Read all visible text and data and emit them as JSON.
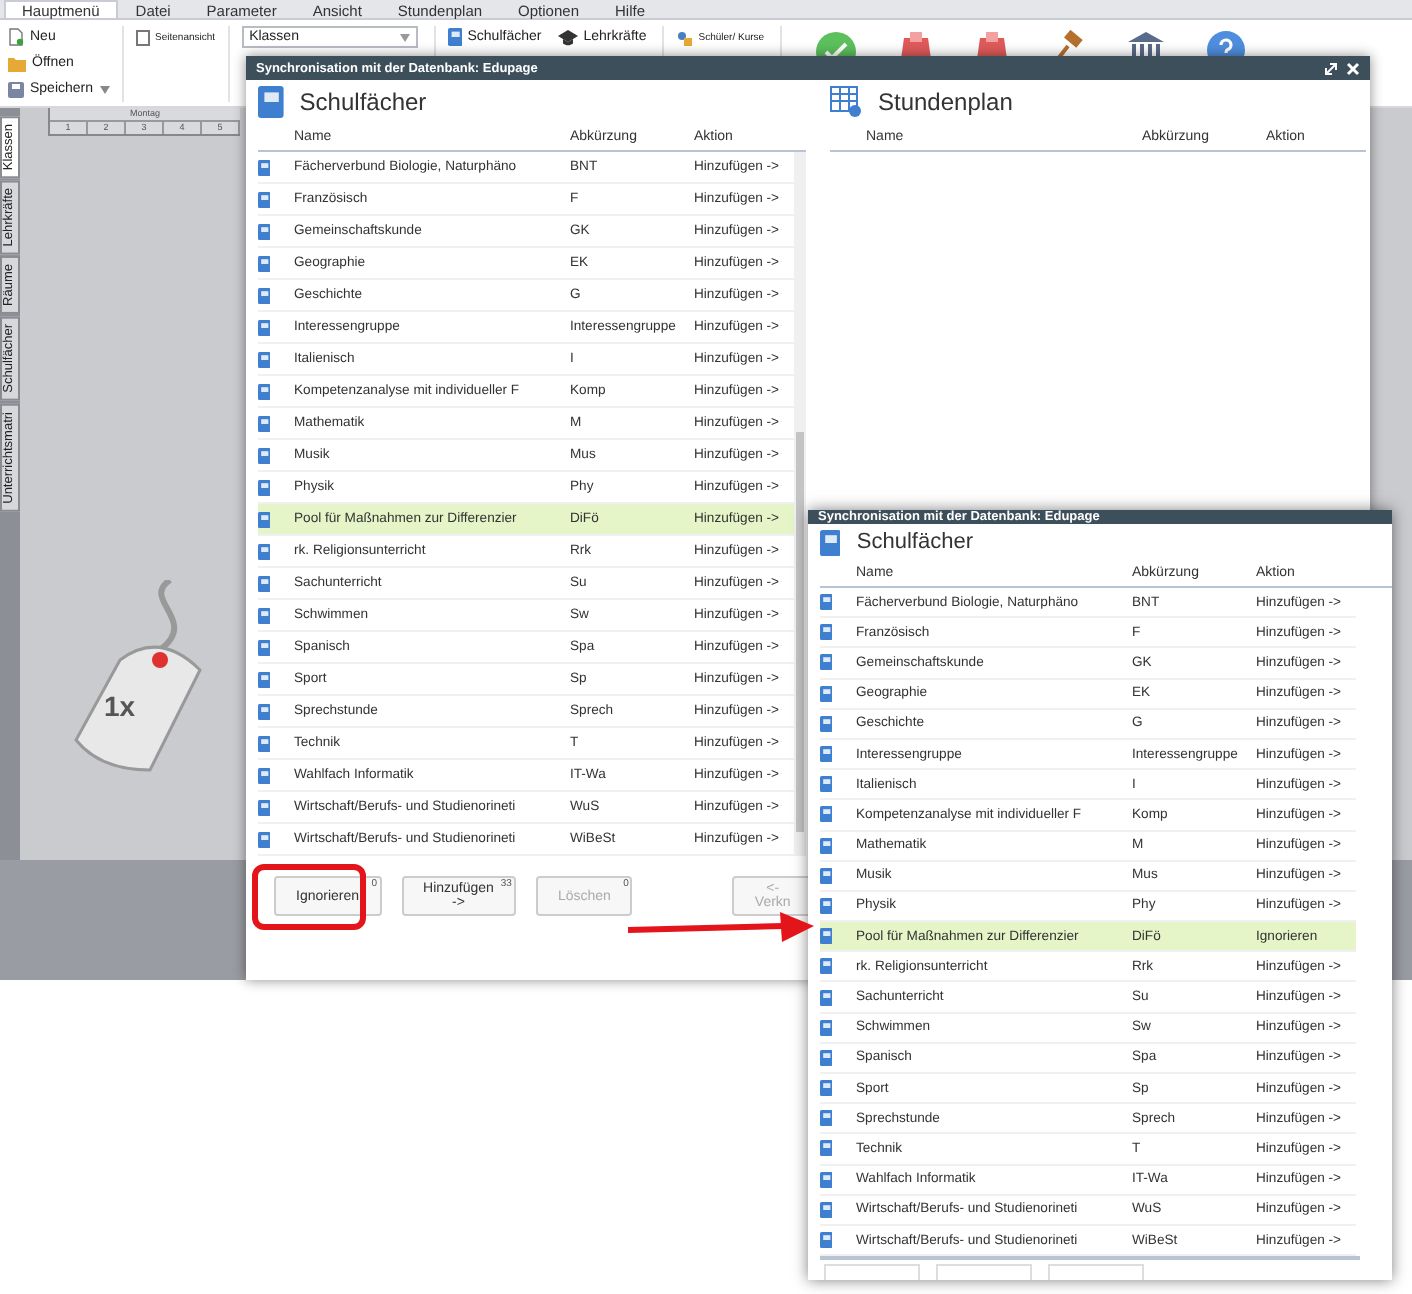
{
  "menu": [
    {
      "label": "Hauptmenü",
      "selected": true
    },
    {
      "label": "Datei",
      "selected": false
    },
    {
      "label": "Parameter",
      "selected": false
    },
    {
      "label": "Ansicht",
      "selected": false
    },
    {
      "label": "Stundenplan",
      "selected": false
    },
    {
      "label": "Optionen",
      "selected": false
    },
    {
      "label": "Hilfe",
      "selected": false
    }
  ],
  "ribbon": {
    "file_items": [
      {
        "kind": "new",
        "label": "Neu"
      },
      {
        "kind": "open",
        "label": "Öffnen"
      },
      {
        "kind": "save",
        "label": "Speichern"
      }
    ],
    "page_view": "Seitenansicht",
    "view_select": "Klassen",
    "list_buttons": [
      {
        "kind": "subject",
        "label": "Schulfächer"
      },
      {
        "kind": "teacher",
        "label": "Lehrkräfte"
      }
    ],
    "students_button": "Schüler/ Kurse"
  },
  "side_tabs": [
    {
      "label": "Klassen",
      "selected": true
    },
    {
      "label": "Lehrkräfte",
      "selected": false
    },
    {
      "label": "Räume",
      "selected": false
    },
    {
      "label": "Schulfächer",
      "selected": false
    },
    {
      "label": "Unterrichtsmatri",
      "selected": false
    }
  ],
  "timetable": {
    "day": "Montag",
    "periods": [
      "1",
      "2",
      "3",
      "4",
      "5"
    ]
  },
  "dialog": {
    "title": "Synchronisation mit der Datenbank: Edupage",
    "left": {
      "title": "Schulfächer",
      "columns": [
        "Name",
        "Abkürzung",
        "Aktion"
      ],
      "rows": [
        {
          "name": "Fächerverbund Biologie, Naturphäno",
          "abbr": "BNT",
          "action": "Hinzufügen ->",
          "selected": false
        },
        {
          "name": "Französisch",
          "abbr": "F",
          "action": "Hinzufügen ->",
          "selected": false
        },
        {
          "name": "Gemeinschaftskunde",
          "abbr": "GK",
          "action": "Hinzufügen ->",
          "selected": false
        },
        {
          "name": "Geographie",
          "abbr": "EK",
          "action": "Hinzufügen ->",
          "selected": false
        },
        {
          "name": "Geschichte",
          "abbr": "G",
          "action": "Hinzufügen ->",
          "selected": false
        },
        {
          "name": "Interessengruppe",
          "abbr": "Interessengruppe",
          "action": "Hinzufügen ->",
          "selected": false
        },
        {
          "name": "Italienisch",
          "abbr": "I",
          "action": "Hinzufügen ->",
          "selected": false
        },
        {
          "name": "Kompetenzanalyse mit individueller F",
          "abbr": "Komp",
          "action": "Hinzufügen ->",
          "selected": false
        },
        {
          "name": "Mathematik",
          "abbr": "M",
          "action": "Hinzufügen ->",
          "selected": false
        },
        {
          "name": "Musik",
          "abbr": "Mus",
          "action": "Hinzufügen ->",
          "selected": false
        },
        {
          "name": "Physik",
          "abbr": "Phy",
          "action": "Hinzufügen ->",
          "selected": false
        },
        {
          "name": "Pool für Maßnahmen zur Differenzier",
          "abbr": "DiFö",
          "action": "Hinzufügen ->",
          "selected": true
        },
        {
          "name": "rk. Religionsunterricht",
          "abbr": "Rrk",
          "action": "Hinzufügen ->",
          "selected": false
        },
        {
          "name": "Sachunterricht",
          "abbr": "Su",
          "action": "Hinzufügen ->",
          "selected": false
        },
        {
          "name": "Schwimmen",
          "abbr": "Sw",
          "action": "Hinzufügen ->",
          "selected": false
        },
        {
          "name": "Spanisch",
          "abbr": "Spa",
          "action": "Hinzufügen ->",
          "selected": false
        },
        {
          "name": "Sport",
          "abbr": "Sp",
          "action": "Hinzufügen ->",
          "selected": false
        },
        {
          "name": "Sprechstunde",
          "abbr": "Sprech",
          "action": "Hinzufügen ->",
          "selected": false
        },
        {
          "name": "Technik",
          "abbr": "T",
          "action": "Hinzufügen ->",
          "selected": false
        },
        {
          "name": "Wahlfach Informatik",
          "abbr": "IT-Wa",
          "action": "Hinzufügen ->",
          "selected": false
        },
        {
          "name": "Wirtschaft/Berufs- und Studienorineti",
          "abbr": "WuS",
          "action": "Hinzufügen ->",
          "selected": false
        },
        {
          "name": "Wirtschaft/Berufs- und Studienorineti",
          "abbr": "WiBeSt",
          "action": "Hinzufügen ->",
          "selected": false
        }
      ]
    },
    "right": {
      "title": "Stundenplan",
      "columns": [
        "Name",
        "Abkürzung",
        "Aktion"
      ]
    },
    "buttons": [
      {
        "label": "Ignorieren",
        "count": "0",
        "disabled": false,
        "highlighted": true
      },
      {
        "label": "Hinzufügen ->",
        "count": "33",
        "disabled": false,
        "highlighted": false
      },
      {
        "label": "Löschen",
        "count": "0",
        "disabled": true,
        "highlighted": false
      }
    ],
    "link_button": "<- Verkn"
  },
  "zoom_inset": {
    "title": "Synchronisation mit der Datenbank: Edupage",
    "panel_title": "Schulfächer",
    "columns": [
      "Name",
      "Abkürzung",
      "Aktion"
    ],
    "rows": [
      {
        "name": "Fächerverbund Biologie, Naturphäno",
        "abbr": "BNT",
        "action": "Hinzufügen ->",
        "selected": false
      },
      {
        "name": "Französisch",
        "abbr": "F",
        "action": "Hinzufügen ->",
        "selected": false
      },
      {
        "name": "Gemeinschaftskunde",
        "abbr": "GK",
        "action": "Hinzufügen ->",
        "selected": false
      },
      {
        "name": "Geographie",
        "abbr": "EK",
        "action": "Hinzufügen ->",
        "selected": false
      },
      {
        "name": "Geschichte",
        "abbr": "G",
        "action": "Hinzufügen ->",
        "selected": false
      },
      {
        "name": "Interessengruppe",
        "abbr": "Interessengruppe",
        "action": "Hinzufügen ->",
        "selected": false
      },
      {
        "name": "Italienisch",
        "abbr": "I",
        "action": "Hinzufügen ->",
        "selected": false
      },
      {
        "name": "Kompetenzanalyse mit individueller F",
        "abbr": "Komp",
        "action": "Hinzufügen ->",
        "selected": false
      },
      {
        "name": "Mathematik",
        "abbr": "M",
        "action": "Hinzufügen ->",
        "selected": false
      },
      {
        "name": "Musik",
        "abbr": "Mus",
        "action": "Hinzufügen ->",
        "selected": false
      },
      {
        "name": "Physik",
        "abbr": "Phy",
        "action": "Hinzufügen ->",
        "selected": false
      },
      {
        "name": "Pool für Maßnahmen zur Differenzier",
        "abbr": "DiFö",
        "action": "Ignorieren",
        "selected": true
      },
      {
        "name": "rk. Religionsunterricht",
        "abbr": "Rrk",
        "action": "Hinzufügen ->",
        "selected": false
      },
      {
        "name": "Sachunterricht",
        "abbr": "Su",
        "action": "Hinzufügen ->",
        "selected": false
      },
      {
        "name": "Schwimmen",
        "abbr": "Sw",
        "action": "Hinzufügen ->",
        "selected": false
      },
      {
        "name": "Spanisch",
        "abbr": "Spa",
        "action": "Hinzufügen ->",
        "selected": false
      },
      {
        "name": "Sport",
        "abbr": "Sp",
        "action": "Hinzufügen ->",
        "selected": false
      },
      {
        "name": "Sprechstunde",
        "abbr": "Sprech",
        "action": "Hinzufügen ->",
        "selected": false
      },
      {
        "name": "Technik",
        "abbr": "T",
        "action": "Hinzufügen ->",
        "selected": false
      },
      {
        "name": "Wahlfach Informatik",
        "abbr": "IT-Wa",
        "action": "Hinzufügen ->",
        "selected": false
      },
      {
        "name": "Wirtschaft/Berufs- und Studienorineti",
        "abbr": "WuS",
        "action": "Hinzufügen ->",
        "selected": false
      },
      {
        "name": "Wirtschaft/Berufs- und Studienorineti",
        "abbr": "WiBeSt",
        "action": "Hinzufügen ->",
        "selected": false
      }
    ]
  },
  "click_hint": "1x"
}
